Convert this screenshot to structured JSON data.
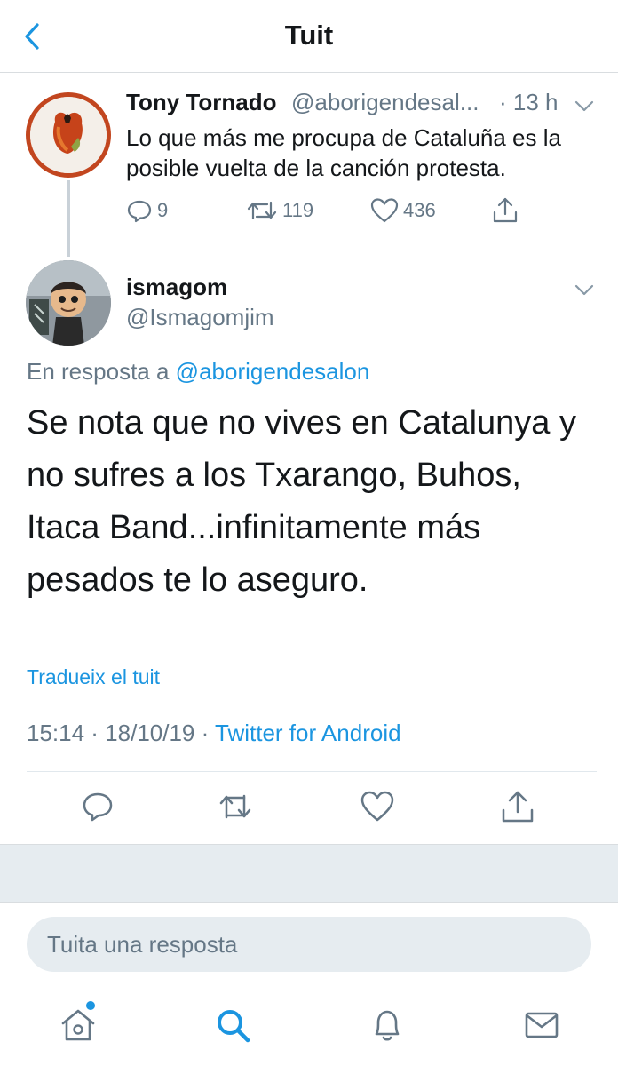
{
  "header": {
    "title": "Tuit",
    "back_icon": "chevron-left-icon"
  },
  "parent_tweet": {
    "author_name": "Tony Tornado",
    "handle": "@aborigendesal...",
    "time": "· 13 h",
    "text": "Lo que más me procupa de Cataluña es la posible vuelta de la canción protesta.",
    "replies": "9",
    "retweets": "119",
    "likes": "436",
    "avatar_border_color": "#c2461f"
  },
  "main_tweet": {
    "author_name": "ismagom",
    "handle": "@Ismagomjim",
    "reply_prefix": "En resposta a",
    "reply_handle": "@aborigendesalon",
    "text": "Se nota que no vives en Catalunya y no sufres a los Txarango, Buhos, Itaca Band...infinitamente más pesados te lo aseguro.",
    "translate_label": "Tradueix el tuit",
    "time": "15:14 · 18/10/19 · ",
    "source": "Twitter for Android"
  },
  "reply_box": {
    "placeholder": "Tuita una resposta"
  },
  "tab_bar": {
    "items": [
      "home-icon",
      "search-icon",
      "bell-icon",
      "mail-icon"
    ],
    "active": "search-icon"
  },
  "colors": {
    "accent": "#1b95e0",
    "secondary_text": "#657786",
    "divider": "#e1e8ed",
    "band": "#e6ecf0"
  }
}
